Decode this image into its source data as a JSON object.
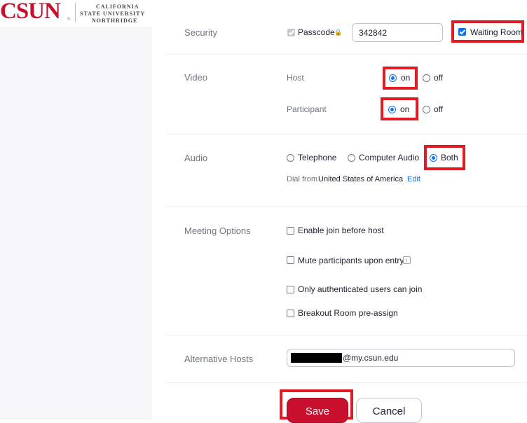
{
  "logo": {
    "word": "CSUN",
    "mark": "®",
    "line1": "CALIFORNIA",
    "line2": "STATE UNIVERSITY",
    "line3": "NORTHRIDGE"
  },
  "security": {
    "label": "Security",
    "passcode_label": "Passcode",
    "passcode_checked": true,
    "passcode_value": "342842",
    "waiting_room_label": "Waiting Room",
    "waiting_room_checked": true
  },
  "video": {
    "label": "Video",
    "host_label": "Host",
    "participant_label": "Participant",
    "on_label": "on",
    "off_label": "off",
    "host_selected": "on",
    "participant_selected": "on"
  },
  "audio": {
    "label": "Audio",
    "options": [
      "Telephone",
      "Computer Audio",
      "Both"
    ],
    "selected": "Both",
    "dial_from_prefix": "Dial from",
    "dial_from_country": "United States of America",
    "edit_label": "Edit"
  },
  "meeting_options": {
    "label": "Meeting Options",
    "items": [
      {
        "label": "Enable join before host",
        "checked": false
      },
      {
        "label": "Mute participants upon entry",
        "checked": false
      },
      {
        "label": "Only authenticated users can join",
        "checked": false
      },
      {
        "label": "Breakout Room pre-assign",
        "checked": false
      }
    ]
  },
  "alternative_hosts": {
    "label": "Alternative Hosts",
    "email_domain": "@my.csun.edu"
  },
  "actions": {
    "save_label": "Save",
    "cancel_label": "Cancel"
  },
  "colors": {
    "brand_red": "#c8102e",
    "highlight_red": "#e01b24",
    "accent_blue": "#0e72ed"
  }
}
